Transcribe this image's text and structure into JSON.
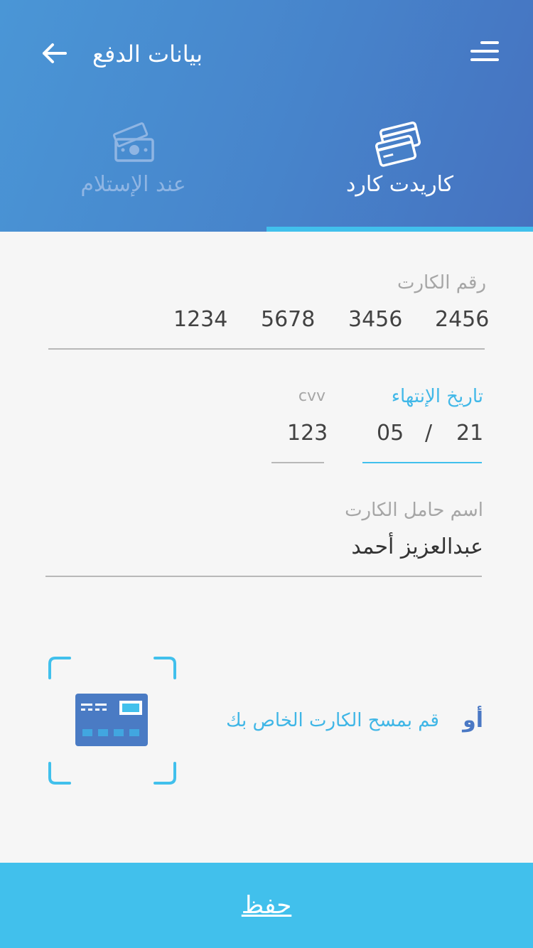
{
  "header": {
    "title": "بيانات الدفع",
    "back_icon": "arrow-left-icon",
    "menu_icon": "menu-icon"
  },
  "tabs": [
    {
      "label": "كاريدت كارد",
      "icon": "credit-cards-icon",
      "selected": true
    },
    {
      "label": "عند الإستلام",
      "icon": "cash-money-icon",
      "selected": false
    }
  ],
  "form": {
    "card_number": {
      "label": "رقم الكارت",
      "groups": [
        "2456",
        "3456",
        "5678",
        "1234"
      ]
    },
    "expiry": {
      "label": "تاريخ الإنتهاء",
      "year": "21",
      "separator": "/",
      "month": "05"
    },
    "cvv": {
      "label": "cvv",
      "value": "123"
    },
    "holder": {
      "label": "اسم حامل الكارت",
      "value": "عبدالعزيز أحمد"
    }
  },
  "scan": {
    "or_label": "أو",
    "text": "قم بمسح الكارت الخاص بك",
    "icon": "scan-card-icon"
  },
  "footer": {
    "save_label": "حفظ"
  },
  "colors": {
    "header_start": "#4a96d6",
    "header_end": "#4672c0",
    "accent": "#41c0ec",
    "or_text": "#4a78c4",
    "card_icon": "#4a7bc4",
    "inactive_tab": "#8fb5e3"
  }
}
